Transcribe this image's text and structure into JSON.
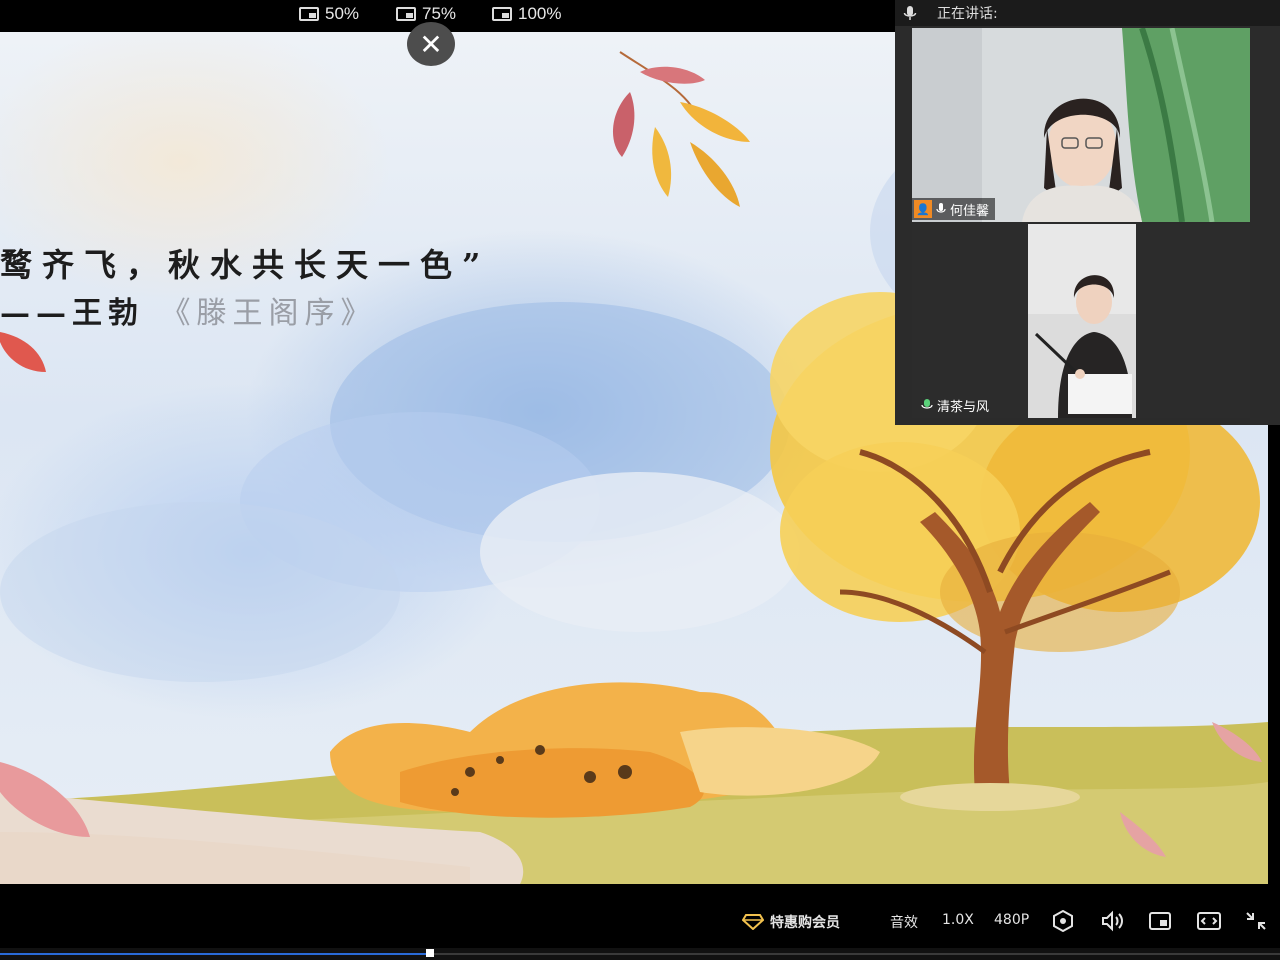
{
  "zoom_options": [
    {
      "label": "50%"
    },
    {
      "label": "75%"
    },
    {
      "label": "100%"
    }
  ],
  "slide": {
    "poem_line": "鹜齐飞，秋水共长天一色”",
    "poem_author": "——王勃",
    "poem_book": "《滕王阁序》"
  },
  "video_panel": {
    "speaking_label": "正在讲话:",
    "participants": [
      {
        "name": "何佳馨"
      },
      {
        "name": "清茶与风"
      }
    ]
  },
  "controls": {
    "vip_label": "特惠购会员",
    "sound_effect": "音效",
    "speed": "1.0X",
    "resolution": "480P"
  },
  "progress": {
    "fraction": 0.336
  },
  "colors": {
    "host_badge": "#f08a24",
    "progress_fill": "#2a6bd8",
    "vip_gold": "#f2c14e"
  }
}
